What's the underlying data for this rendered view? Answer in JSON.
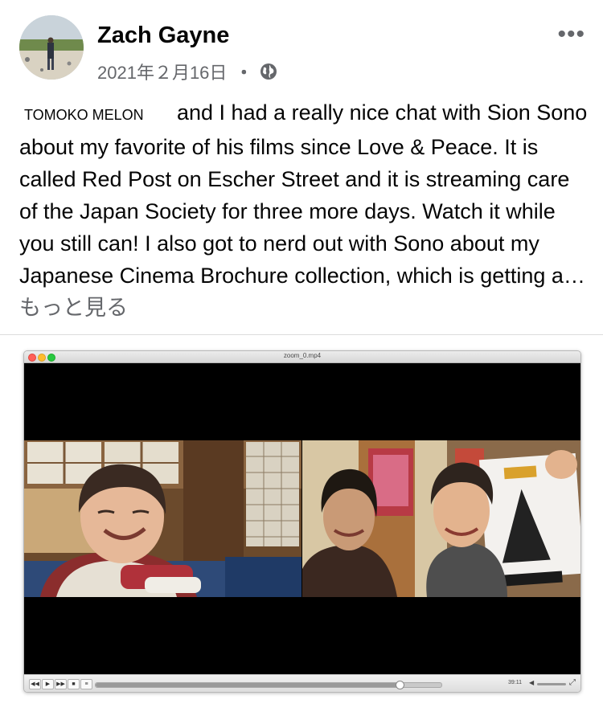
{
  "post": {
    "author": "Zach Gayne",
    "date": "2021年２月16日",
    "dot": "・",
    "privacy_icon": "globe-icon",
    "more_icon": "•••",
    "mention": "TOMOKO MELON",
    "body": "and I had a really nice chat with Sion Sono about my favorite of his films since Love & Peace. It is called Red Post on Escher Street and it is streaming care of the Japan Society for three more days. Watch it while you still can! I also got to nerd out with Sono about my Japanese Cinema Brochure collection, which is getting a…",
    "see_more": "もっと見る"
  },
  "player": {
    "filename": "zoom_0.mp4",
    "timecode": "39:11",
    "progress": 0.88,
    "volume": 0.8
  },
  "colors": {
    "text": "#050505",
    "secondary": "#65676b",
    "video_bg": "#000000"
  }
}
